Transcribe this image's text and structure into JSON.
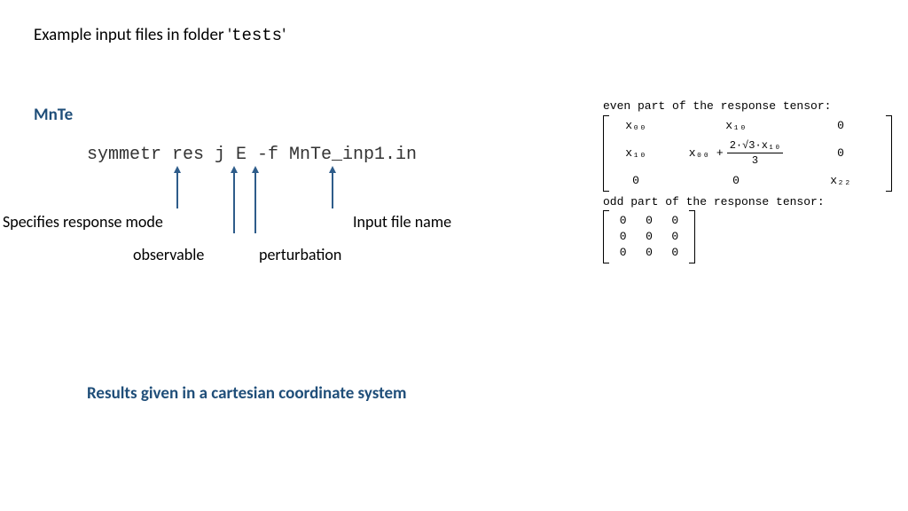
{
  "title_prefix": "Example input files in folder '",
  "title_folder": "tests",
  "title_suffix": "'",
  "mnte": "MnTe",
  "command": "symmetr res j E -f MnTe_inp1.in",
  "labels": {
    "response_mode": "Specifies response mode",
    "observable": "observable",
    "perturbation": "perturbation",
    "input_file": "Input file name"
  },
  "results_note": "Results given in a cartesian coordinate system",
  "output": {
    "even_header": "even part of the response tensor:",
    "odd_header": "odd part of the response tensor:",
    "even_matrix": {
      "r0": [
        "x₀₀",
        "x₁₀",
        "0"
      ],
      "r1_a": "x₁₀",
      "r1_b_pre": "x₀₀ +",
      "r1_b_num": "2·√3·x₁₀",
      "r1_b_den": "3",
      "r1_c": "0",
      "r2": [
        "0",
        "0",
        "x₂₂"
      ]
    },
    "odd_matrix": [
      [
        "0",
        "0",
        "0"
      ],
      [
        "0",
        "0",
        "0"
      ],
      [
        "0",
        "0",
        "0"
      ]
    ]
  }
}
